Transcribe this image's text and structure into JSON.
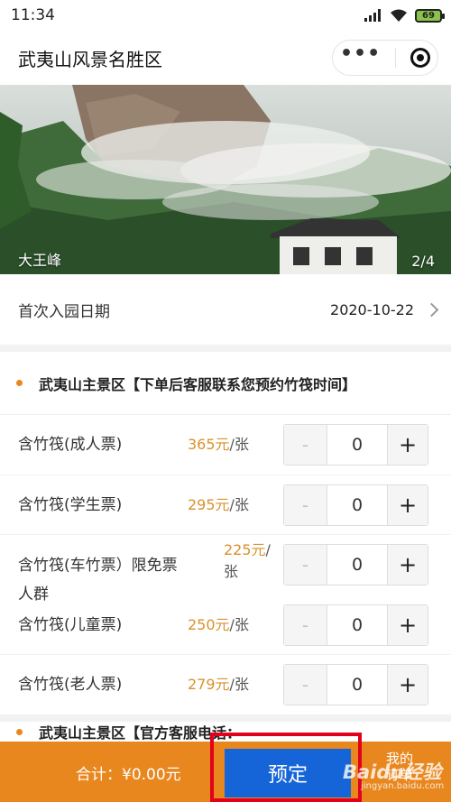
{
  "status_bar": {
    "time": "11:34",
    "battery": "69"
  },
  "title_bar": {
    "title": "武夷山风景名胜区",
    "more_icon": "more-dots-icon",
    "close_icon": "target-icon"
  },
  "banner": {
    "caption": "大王峰",
    "counter": "2/4"
  },
  "date_row": {
    "label": "首次入园日期",
    "value": "2020-10-22"
  },
  "section1": {
    "title": "武夷山主景区【下单后客服联系您预约竹筏时间】"
  },
  "tickets": [
    {
      "name": "含竹筏(成人票)",
      "price": "365元",
      "unit": "/张",
      "qty": "0",
      "minus": "-",
      "plus": "+"
    },
    {
      "name": "含竹筏(学生票)",
      "price": "295元",
      "unit": "/张",
      "qty": "0",
      "minus": "-",
      "plus": "+"
    },
    {
      "name_line1": "含竹筏(车竹票）限免票",
      "name_line2": "人群",
      "price": "225元",
      "unit": "/",
      "unit2": "张",
      "qty": "0",
      "minus": "-",
      "plus": "+"
    },
    {
      "name": "含竹筏(儿童票)",
      "price": "250元",
      "unit": "/张",
      "qty": "0",
      "minus": "-",
      "plus": "+"
    },
    {
      "name": "含竹筏(老人票)",
      "price": "279元",
      "unit": "/张",
      "qty": "0",
      "minus": "-",
      "plus": "+"
    }
  ],
  "section2": {
    "title": "武夷山主景区【官方客服电话："
  },
  "footer": {
    "total": "合计：¥0.00元",
    "book": "预定",
    "mine_line1": "我的",
    "mine_line2": "订单"
  },
  "watermark": {
    "text": "Baidu经验",
    "sub": "jingyan.baidu.com"
  },
  "colors": {
    "accent": "#e8871e",
    "book_button": "#1565d8",
    "highlight_box": "#e3001b",
    "price": "#d9912c"
  }
}
